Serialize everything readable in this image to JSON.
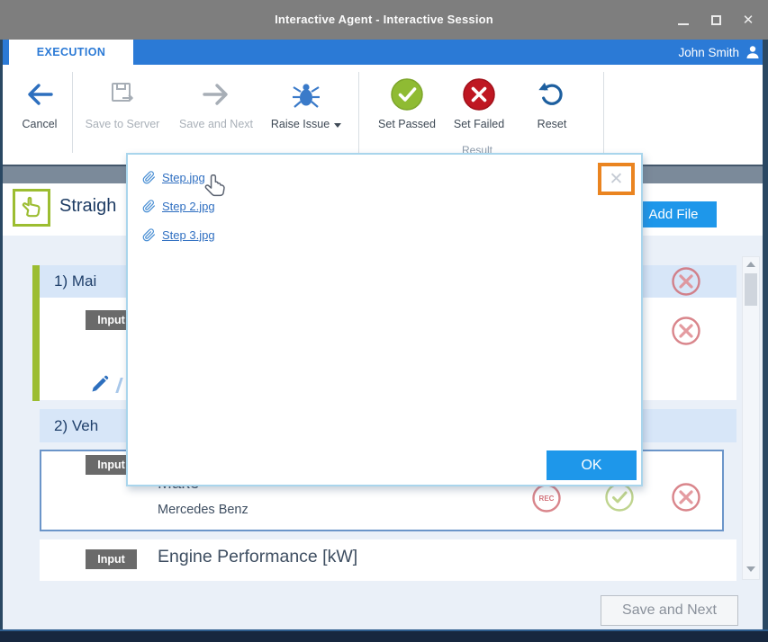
{
  "window": {
    "title": "Interactive Agent - Interactive Session",
    "close_glyph": "✕"
  },
  "ribbon": {
    "tab_label": "EXECUTION",
    "user_name": "John Smith",
    "group_label": "Result",
    "buttons": [
      {
        "label": "Cancel",
        "state": "enabled"
      },
      {
        "label": "Save to Server",
        "state": "disabled"
      },
      {
        "label": "Save and Next",
        "state": "disabled"
      },
      {
        "label": "Raise Issue",
        "state": "enabled",
        "has_dropdown": true
      },
      {
        "label": "Set Passed",
        "state": "enabled"
      },
      {
        "label": "Set Failed",
        "state": "enabled"
      },
      {
        "label": "Reset",
        "state": "enabled"
      }
    ]
  },
  "dialog": {
    "files": [
      "Step.jpg",
      "Step 2.jpg",
      "Step 3.jpg"
    ],
    "close_glyph": "✕",
    "ok_label": "OK"
  },
  "content": {
    "step_title_partial": "Straigh",
    "add_file_label": "Add File",
    "sections": [
      {
        "title_partial": "1) Mai",
        "badge": "Input"
      },
      {
        "title_partial": "2) Veh"
      }
    ],
    "fields": [
      {
        "badge": "Input",
        "label": "Make",
        "value": "Mercedes Benz",
        "rec_label": "REC"
      },
      {
        "badge": "Input",
        "label": "Engine Performance [kW]"
      }
    ],
    "save_and_next_label": "Save and Next"
  },
  "icons": {
    "minimize": "bar-shape",
    "maximize": "square-outline",
    "close": "✕",
    "user": "person-silhouette",
    "cancel": "left-arrow",
    "save_to_server": "floppy-disk-arrow",
    "save_and_next": "right-arrow",
    "raise_issue": "bug",
    "set_passed": "green-circle-check",
    "set_failed": "red-circle-cross",
    "reset": "undo-arrow",
    "step_type": "pointing-hand",
    "attachment": "paperclip",
    "edit": "pencil",
    "status_fail": "red-outline-circle-cross",
    "status_pass": "green-outline-circle-check",
    "status_rec": "red-outline-circle-rec"
  },
  "colors": {
    "titlebar_gray": "#7e7e7e",
    "ribbon_blue": "#2b7ad6",
    "accent_blue": "#1e97ea",
    "link_blue": "#2f6fc1",
    "active_green": "#9cbd31",
    "pass_green": "#8fbb33",
    "fail_red": "#bf1722",
    "status_red": "#cf666e",
    "status_green": "#b8cf82",
    "highlight_orange": "#ea8420",
    "section_header_blue": "#d7e6f8",
    "band_slate": "#7b8a9a",
    "bottom_navy": "#17273f"
  }
}
